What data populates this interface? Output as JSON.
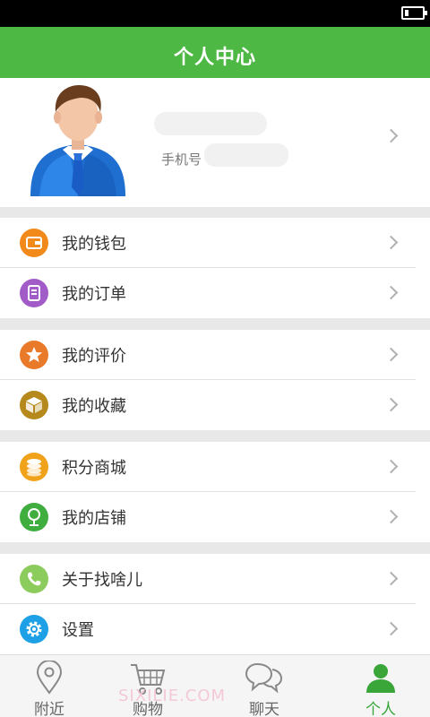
{
  "header": {
    "title": "个人中心"
  },
  "profile": {
    "phone_label": "手机号"
  },
  "menu_groups": [
    [
      {
        "label": "我的钱包",
        "icon": "wallet-icon",
        "color": "#f28a1b"
      },
      {
        "label": "我的订单",
        "icon": "order-icon",
        "color": "#a25cc8"
      }
    ],
    [
      {
        "label": "我的评价",
        "icon": "star-icon",
        "color": "#e87a2a"
      },
      {
        "label": "我的收藏",
        "icon": "box-icon",
        "color": "#b5891c"
      }
    ],
    [
      {
        "label": "积分商城",
        "icon": "coins-icon",
        "color": "#f0a21b"
      },
      {
        "label": "我的店铺",
        "icon": "map-pin-icon",
        "color": "#3fae3f"
      }
    ],
    [
      {
        "label": "关于找啥儿",
        "icon": "phone-icon",
        "color": "#8ccc5c"
      },
      {
        "label": "设置",
        "icon": "gear-icon",
        "color": "#1ea0e6"
      }
    ]
  ],
  "tabs": [
    {
      "label": "附近",
      "icon": "location-pin-icon",
      "active": false
    },
    {
      "label": "购物",
      "icon": "cart-icon",
      "active": false
    },
    {
      "label": "聊天",
      "icon": "chat-bubbles-icon",
      "active": false
    },
    {
      "label": "个人",
      "icon": "person-icon",
      "active": true
    }
  ],
  "watermark": "SIXILIE.COM"
}
